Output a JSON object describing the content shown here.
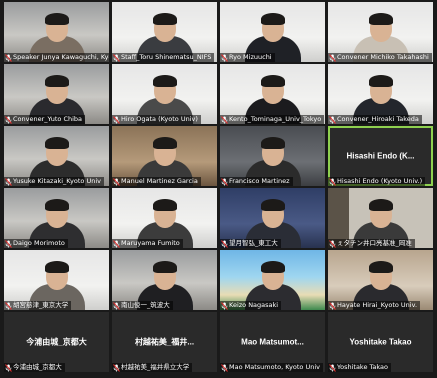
{
  "tiles": [
    {
      "name": "Speaker Junya Kawaguchi, Kyoto",
      "muted": true,
      "scene": "room",
      "shirt": "#7a6e62",
      "video": true
    },
    {
      "name": "Staff_Toru Shinematsu_NIFS",
      "muted": true,
      "scene": "white",
      "shirt": "#3a3c40",
      "video": true
    },
    {
      "name": "Ryo Mizuuchi",
      "muted": true,
      "scene": "white",
      "shirt": "#1f2126",
      "video": true
    },
    {
      "name": "Convener Michiko Takahashi",
      "muted": true,
      "scene": "white",
      "shirt": "#c8c0b4",
      "video": true
    },
    {
      "name": "Convener_Yuto Chiba",
      "muted": true,
      "scene": "room",
      "shirt": "#2a2a2e",
      "video": true
    },
    {
      "name": "Hiro Ogata (Kyoto Univ)",
      "muted": true,
      "scene": "white",
      "shirt": "#4a4a4a",
      "video": true
    },
    {
      "name": "Kento_Tominaga_Univ_Tokyo",
      "muted": true,
      "scene": "white",
      "shirt": "#1b1b1e",
      "video": true
    },
    {
      "name": "Convener_Hiroaki Takeda",
      "muted": true,
      "scene": "white",
      "shirt": "#23262c",
      "video": true
    },
    {
      "name": "Yusuke Kitazaki_Kyoto Univ",
      "muted": true,
      "scene": "room",
      "shirt": "#2c2c2c",
      "video": true
    },
    {
      "name": "Manuel Martinez Garcia",
      "muted": true,
      "scene": "wood",
      "shirt": "#3a3a3a",
      "video": true
    },
    {
      "name": "Francisco Martinez",
      "muted": true,
      "scene": "dark",
      "shirt": "#2b2b2b",
      "video": true
    },
    {
      "name": "Hisashi Endo (Kyoto Univ.)",
      "muted": true,
      "scene": "none",
      "shirt": "#000",
      "video": false,
      "active": true,
      "center": "Hisashi Endo (K..."
    },
    {
      "name": "Daigo Morimoto",
      "muted": true,
      "scene": "room",
      "shirt": "#2e2e30",
      "video": true
    },
    {
      "name": "Maruyama Fumito",
      "muted": true,
      "scene": "white",
      "shirt": "#3c3c3c",
      "video": true
    },
    {
      "name": "望月智弘_東工大",
      "muted": true,
      "scene": "blue",
      "shirt": "#2a2d36",
      "video": true
    },
    {
      "name": "ぇタチン井口亮基准_岡准",
      "muted": true,
      "scene": "shelf",
      "shirt": "#3a3a3a",
      "video": true
    },
    {
      "name": "胡宮慈津_東京大学",
      "muted": true,
      "scene": "white",
      "shirt": "#6b6660",
      "video": true
    },
    {
      "name": "南山俊一_筑波大",
      "muted": true,
      "scene": "room",
      "shirt": "#1f1f22",
      "video": true
    },
    {
      "name": "Keizo Nagasaki",
      "muted": true,
      "scene": "beach",
      "shirt": "#2c2c30",
      "video": true
    },
    {
      "name": "Hayate Hirai_Kyoto Univ.",
      "muted": true,
      "scene": "warm",
      "shirt": "#2a2a2e",
      "video": true
    },
    {
      "name": "今浦由城_京都大",
      "muted": true,
      "scene": "none",
      "video": false,
      "center": "今浦由城_京都大"
    },
    {
      "name": "村越祐美_福井県立大学",
      "muted": true,
      "scene": "none",
      "video": false,
      "center": "村越祐美_福井..."
    },
    {
      "name": "Mao Matsumoto, Kyoto Univ",
      "muted": true,
      "scene": "none",
      "video": false,
      "center": "Mao Matsumot..."
    },
    {
      "name": "Yoshitake Takao",
      "muted": true,
      "scene": "none",
      "video": false,
      "center": "Yoshitake Takao"
    }
  ]
}
